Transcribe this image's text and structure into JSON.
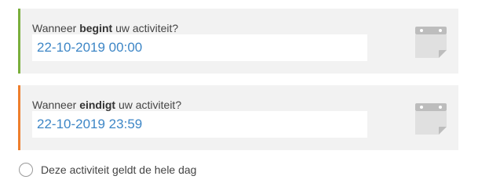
{
  "start": {
    "question_prefix": "Wanneer ",
    "question_bold": "begint",
    "question_suffix": " uw activiteit?",
    "value": "22-10-2019 00:00",
    "accent_color": "#7aaf3c",
    "icon": "calendar-icon"
  },
  "end": {
    "question_prefix": "Wanneer ",
    "question_bold": "eindigt",
    "question_suffix": " uw activiteit?",
    "value": "22-10-2019 23:59",
    "accent_color": "#ee7f2d",
    "icon": "calendar-icon"
  },
  "all_day": {
    "label": "Deze activiteit geldt de hele dag",
    "checked": false
  },
  "colors": {
    "value_text": "#3d86c6",
    "panel_bg": "#f2f2f2"
  }
}
